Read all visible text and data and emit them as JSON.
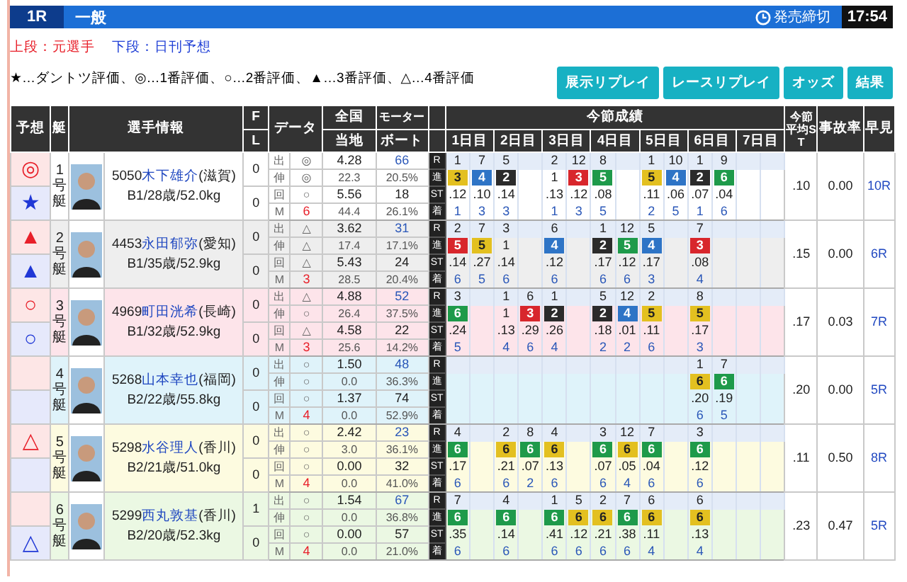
{
  "race_bar": {
    "race": "1R",
    "grade": "一般",
    "deadline_label": "発売締切",
    "deadline_time": "17:54"
  },
  "legend": {
    "former": "上段：元選手",
    "nikkan": "下段：日刊予想",
    "marks": "★…ダントツ評価、◎…1番評価、○…2番評価、▲…3番評価、△…4番評価"
  },
  "buttons": [
    "展示リプレイ",
    "レースリプレイ",
    "オッズ",
    "結果"
  ],
  "table": {
    "headers": {
      "prediction": "予想",
      "boat": "艇",
      "player": "選手情報",
      "f": "F",
      "l": "L",
      "data": "データ",
      "national": "全国",
      "local": "当地",
      "motor": "モーター",
      "boat_no": "ボート",
      "results": "今節成績",
      "days": [
        "1日目",
        "2日目",
        "3日目",
        "4日目",
        "5日目",
        "6日目",
        "7日目"
      ],
      "avg_st": "今節平均ST",
      "accident": "事故率",
      "quick": "早見"
    },
    "boats": [
      {
        "boat": "1号艇",
        "prediction": {
          "former": "◎",
          "nikkan": "★"
        },
        "number": "5050",
        "name": "木下雄介",
        "branch": "(滋賀)",
        "profile": "B1/28歳/52.0kg",
        "f": "0",
        "l": "0",
        "data": [
          {
            "label": "出",
            "value": "◎",
            "kind": "mark"
          },
          {
            "label": "伸",
            "value": "◎",
            "kind": "mark"
          },
          {
            "label": "回",
            "value": "○",
            "kind": "mark"
          },
          {
            "label": "M",
            "value": "6",
            "kind": "count"
          }
        ],
        "national": [
          "4.28",
          "22.3"
        ],
        "local": [
          "5.56",
          "44.4"
        ],
        "motor": [
          "66",
          "20.5%"
        ],
        "boat_no": [
          "18",
          "26.1%"
        ],
        "row_labels": [
          "R",
          "進",
          "ST",
          "着"
        ],
        "days": [
          {
            "kind": "raced",
            "races": [
              {
                "race": "1",
                "course": "3",
                "color": "#e3c020",
                "st": ".12",
                "finish": "1"
              },
              {
                "race": "7",
                "course": "4",
                "color": "#2e74c6",
                "st": ".10",
                "finish": "3"
              }
            ]
          },
          {
            "kind": "raced",
            "races": [
              {
                "race": "5",
                "course": "2",
                "color": "#2b2b2b",
                "st": ".14",
                "finish": "3"
              }
            ]
          },
          {
            "kind": "raced",
            "races": [
              {
                "race": "2",
                "course": "1",
                "st": ".13",
                "finish": "1"
              },
              {
                "race": "12",
                "course": "3",
                "color": "#d8262c",
                "st": ".12",
                "finish": "3"
              }
            ]
          },
          {
            "kind": "raced",
            "races": [
              {
                "race": "8",
                "course": "5",
                "color": "#1e9a4a",
                "st": ".08",
                "finish": "5"
              }
            ]
          },
          {
            "kind": "raced",
            "races": [
              {
                "race": "1",
                "course": "5",
                "color": "#e3c020",
                "st": ".11",
                "finish": "2"
              },
              {
                "race": "10",
                "course": "4",
                "color": "#2e74c6",
                "st": ".06",
                "finish": "5"
              }
            ]
          },
          {
            "kind": "raced",
            "races": [
              {
                "race": "1",
                "course": "2",
                "color": "#2b2b2b",
                "st": ".07",
                "finish": "1"
              },
              {
                "race": "9",
                "course": "6",
                "color": "#1e9a4a",
                "st": ".04",
                "finish": "6"
              }
            ]
          },
          {
            "kind": "blank"
          }
        ],
        "avg_st": ".10",
        "accident": "0.00",
        "quick": "10R"
      },
      {
        "boat": "2号艇",
        "prediction": {
          "former": "▲",
          "nikkan": "▲"
        },
        "number": "4453",
        "name": "永田郁弥",
        "branch": "(愛知)",
        "profile": "B1/35歳/52.9kg",
        "f": "0",
        "l": "0",
        "data": [
          {
            "label": "出",
            "value": "△",
            "kind": "mark"
          },
          {
            "label": "伸",
            "value": "△",
            "kind": "mark"
          },
          {
            "label": "回",
            "value": "△",
            "kind": "mark"
          },
          {
            "label": "M",
            "value": "3",
            "kind": "count"
          }
        ],
        "national": [
          "3.62",
          "17.4"
        ],
        "local": [
          "5.43",
          "28.5"
        ],
        "motor": [
          "31",
          "17.1%"
        ],
        "boat_no": [
          "24",
          "20.4%"
        ],
        "row_labels": [
          "R",
          "進",
          "ST",
          "着"
        ],
        "days": [
          {
            "kind": "raced",
            "races": [
              {
                "race": "2",
                "course": "5",
                "color": "#d8262c",
                "st": ".14",
                "finish": "6"
              },
              {
                "race": "7",
                "course": "5",
                "color": "#e3c020",
                "st": ".27",
                "finish": "5"
              }
            ]
          },
          {
            "kind": "raced",
            "races": [
              {
                "race": "3",
                "course": "1",
                "st": ".14",
                "finish": "6"
              }
            ]
          },
          {
            "kind": "raced",
            "races": [
              {
                "race": "6",
                "course": "4",
                "color": "#2e74c6",
                "st": ".12",
                "finish": "6"
              }
            ]
          },
          {
            "kind": "raced",
            "races": [
              {
                "race": "1",
                "course": "2",
                "color": "#2b2b2b",
                "st": ".17",
                "finish": "6"
              },
              {
                "race": "12",
                "course": "5",
                "color": "#1e9a4a",
                "st": ".12",
                "finish": "6"
              }
            ]
          },
          {
            "kind": "raced",
            "races": [
              {
                "race": "5",
                "course": "4",
                "color": "#2e74c6",
                "st": ".17",
                "finish": "3"
              }
            ]
          },
          {
            "kind": "raced",
            "races": [
              {
                "race": "7",
                "course": "3",
                "color": "#d8262c",
                "st": ".08",
                "finish": "4"
              }
            ]
          },
          {
            "kind": "blank"
          }
        ],
        "avg_st": ".15",
        "accident": "0.00",
        "quick": "6R"
      },
      {
        "boat": "3号艇",
        "prediction": {
          "former": "○",
          "nikkan": "○"
        },
        "number": "4969",
        "name": "町田洸希",
        "branch": "(長崎)",
        "profile": "B1/32歳/52.9kg",
        "f": "0",
        "l": "0",
        "data": [
          {
            "label": "出",
            "value": "△",
            "kind": "mark"
          },
          {
            "label": "伸",
            "value": "○",
            "kind": "mark"
          },
          {
            "label": "回",
            "value": "△",
            "kind": "mark"
          },
          {
            "label": "M",
            "value": "3",
            "kind": "count"
          }
        ],
        "national": [
          "4.88",
          "26.4"
        ],
        "local": [
          "4.58",
          "25.6"
        ],
        "motor": [
          "52",
          "37.5%"
        ],
        "boat_no": [
          "22",
          "14.2%"
        ],
        "row_labels": [
          "R",
          "進",
          "ST",
          "着"
        ],
        "days": [
          {
            "kind": "raced",
            "races": [
              {
                "race": "3",
                "course": "6",
                "color": "#1e9a4a",
                "st": ".24",
                "finish": "5"
              }
            ]
          },
          {
            "kind": "raced",
            "races": [
              {
                "race": "1",
                "course": "1",
                "st": ".13",
                "finish": "4"
              },
              {
                "race": "6",
                "course": "3",
                "color": "#d8262c",
                "st": ".29",
                "finish": "6"
              }
            ]
          },
          {
            "kind": "raced",
            "races": [
              {
                "race": "1",
                "course": "2",
                "color": "#2b2b2b",
                "st": ".26",
                "finish": "4"
              }
            ]
          },
          {
            "kind": "raced",
            "races": [
              {
                "race": "5",
                "course": "2",
                "color": "#2b2b2b",
                "st": ".18",
                "finish": "2"
              },
              {
                "race": "12",
                "course": "4",
                "color": "#2e74c6",
                "st": ".01",
                "finish": "2"
              }
            ]
          },
          {
            "kind": "raced",
            "races": [
              {
                "race": "2",
                "course": "5",
                "color": "#e3c020",
                "st": ".11",
                "finish": "6"
              }
            ]
          },
          {
            "kind": "raced",
            "races": [
              {
                "race": "8",
                "course": "5",
                "color": "#e3c020",
                "st": ".17",
                "finish": "3"
              }
            ]
          },
          {
            "kind": "blank"
          }
        ],
        "avg_st": ".17",
        "accident": "0.03",
        "quick": "7R"
      },
      {
        "boat": "4号艇",
        "number": "5268",
        "name": "山本幸也",
        "branch": "(福岡)",
        "profile": "B2/22歳/55.8kg",
        "f": "0",
        "l": "0",
        "data": [
          {
            "label": "出",
            "value": "○",
            "kind": "mark"
          },
          {
            "label": "伸",
            "value": "○",
            "kind": "mark"
          },
          {
            "label": "回",
            "value": "○",
            "kind": "mark"
          },
          {
            "label": "M",
            "value": "4",
            "kind": "count"
          }
        ],
        "national": [
          "1.50",
          "0.0"
        ],
        "local": [
          "1.37",
          "0.0"
        ],
        "motor": [
          "48",
          "36.3%"
        ],
        "boat_no": [
          "74",
          "52.9%"
        ],
        "row_labels": [
          "R",
          "進",
          "ST",
          "着"
        ],
        "days": [
          {
            "kind": "blank"
          },
          {
            "kind": "blank"
          },
          {
            "kind": "blank"
          },
          {
            "kind": "blank"
          },
          {
            "kind": "blank"
          },
          {
            "kind": "raced",
            "races": [
              {
                "race": "1",
                "course": "6",
                "color": "#e3c020",
                "st": ".20",
                "finish": "6"
              },
              {
                "race": "7",
                "course": "6",
                "color": "#1e9a4a",
                "st": ".19",
                "finish": "5"
              }
            ]
          },
          {
            "kind": "blank"
          }
        ],
        "avg_st": ".20",
        "accident": "0.00",
        "quick": "5R"
      },
      {
        "boat": "5号艇",
        "prediction": {
          "former": "△"
        },
        "number": "5298",
        "name": "水谷理人",
        "branch": "(香川)",
        "profile": "B2/21歳/51.0kg",
        "f": "0",
        "l": "0",
        "data": [
          {
            "label": "出",
            "value": "○",
            "kind": "mark"
          },
          {
            "label": "伸",
            "value": "○",
            "kind": "mark"
          },
          {
            "label": "回",
            "value": "○",
            "kind": "mark"
          },
          {
            "label": "M",
            "value": "4",
            "kind": "count"
          }
        ],
        "national": [
          "2.42",
          "3.0"
        ],
        "local": [
          "0.00",
          "0.0"
        ],
        "motor": [
          "23",
          "36.1%"
        ],
        "boat_no": [
          "32",
          "41.0%"
        ],
        "row_labels": [
          "R",
          "進",
          "ST",
          "着"
        ],
        "days": [
          {
            "kind": "raced",
            "races": [
              {
                "race": "4",
                "course": "6",
                "color": "#1e9a4a",
                "st": ".17",
                "finish": "6"
              }
            ]
          },
          {
            "kind": "raced",
            "races": [
              {
                "race": "2",
                "course": "6",
                "color": "#e3c020",
                "st": ".21",
                "finish": "6"
              },
              {
                "race": "8",
                "course": "6",
                "color": "#1e9a4a",
                "st": ".07",
                "finish": "2"
              }
            ]
          },
          {
            "kind": "raced",
            "races": [
              {
                "race": "4",
                "course": "6",
                "color": "#e3c020",
                "st": ".13",
                "finish": "6"
              }
            ]
          },
          {
            "kind": "raced",
            "races": [
              {
                "race": "3",
                "course": "6",
                "color": "#1e9a4a",
                "st": ".07",
                "finish": "6"
              },
              {
                "race": "12",
                "course": "6",
                "color": "#e3c020",
                "st": ".05",
                "finish": "4"
              }
            ]
          },
          {
            "kind": "raced",
            "races": [
              {
                "race": "7",
                "course": "6",
                "color": "#1e9a4a",
                "st": ".04",
                "finish": "6"
              }
            ]
          },
          {
            "kind": "raced",
            "races": [
              {
                "race": "3",
                "course": "6",
                "color": "#1e9a4a",
                "st": ".12",
                "finish": "6"
              }
            ]
          },
          {
            "kind": "blank"
          }
        ],
        "avg_st": ".11",
        "accident": "0.50",
        "quick": "8R"
      },
      {
        "boat": "6号艇",
        "prediction": {
          "nikkan": "△"
        },
        "number": "5299",
        "name": "西丸敦基",
        "branch": "(香川)",
        "profile": "B2/20歳/52.3kg",
        "f": "1",
        "l": "0",
        "data": [
          {
            "label": "出",
            "value": "○",
            "kind": "mark"
          },
          {
            "label": "伸",
            "value": "○",
            "kind": "mark"
          },
          {
            "label": "回",
            "value": "○",
            "kind": "mark"
          },
          {
            "label": "M",
            "value": "4",
            "kind": "count"
          }
        ],
        "national": [
          "1.54",
          "0.0"
        ],
        "local": [
          "0.00",
          "0.0"
        ],
        "motor": [
          "67",
          "36.8%"
        ],
        "boat_no": [
          "57",
          "21.0%"
        ],
        "row_labels": [
          "R",
          "進",
          "ST",
          "着"
        ],
        "days": [
          {
            "kind": "raced",
            "races": [
              {
                "race": "7",
                "course": "6",
                "color": "#1e9a4a",
                "st": ".35",
                "finish": "6"
              }
            ]
          },
          {
            "kind": "raced",
            "races": [
              {
                "race": "4",
                "course": "6",
                "color": "#1e9a4a",
                "st": ".14",
                "finish": "6"
              }
            ]
          },
          {
            "kind": "raced",
            "races": [
              {
                "race": "1",
                "course": "6",
                "color": "#1e9a4a",
                "st": ".41",
                "finish": "6"
              },
              {
                "race": "5",
                "course": "6",
                "color": "#e3c020",
                "st": ".12",
                "finish": "6"
              }
            ]
          },
          {
            "kind": "raced",
            "races": [
              {
                "race": "2",
                "course": "6",
                "color": "#e3c020",
                "st": ".21",
                "finish": "6"
              },
              {
                "race": "7",
                "course": "6",
                "color": "#1e9a4a",
                "st": ".38",
                "finish": "6"
              }
            ]
          },
          {
            "kind": "raced",
            "races": [
              {
                "race": "6",
                "course": "6",
                "color": "#e3c020",
                "st": ".11",
                "finish": "4"
              }
            ]
          },
          {
            "kind": "raced",
            "races": [
              {
                "race": "6",
                "course": "6",
                "color": "#e3c020",
                "st": ".13",
                "finish": "4"
              }
            ]
          },
          {
            "kind": "blank"
          }
        ],
        "avg_st": ".23",
        "accident": "0.47",
        "quick": "5R"
      }
    ]
  }
}
